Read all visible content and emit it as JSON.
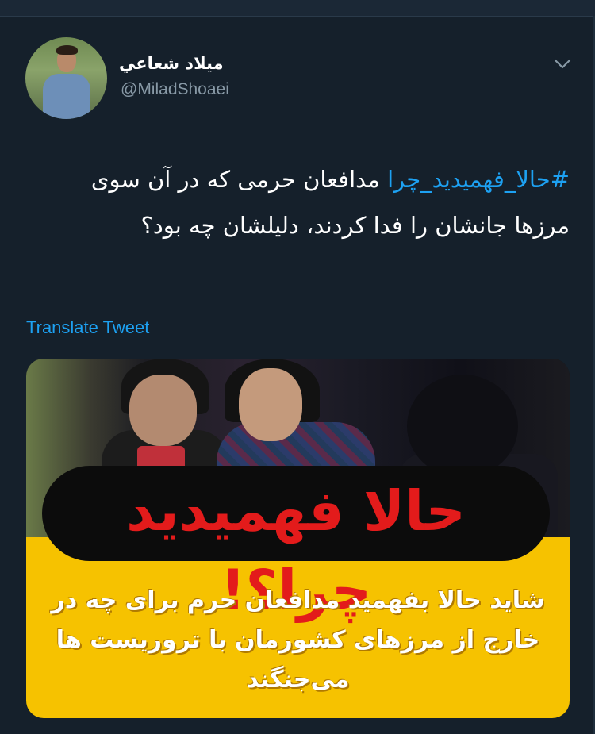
{
  "tweet": {
    "display_name": "ميلاد شعاعي",
    "handle": "@MiladShoaei",
    "hashtag": "#حالا_فهمیدید_چرا",
    "text": " مدافعان حرمی که در آن سوی مرزها جانشان را فدا کردند، دلیلشان چه بود؟",
    "translate_label": "Translate Tweet",
    "menu_icon": "chevron-down-icon"
  },
  "media": {
    "headline": "حالا فهمیدید چرا؟!",
    "subtext_line1": "شاید حالا بفهمید  مدافعان حرم برای چه در",
    "subtext_line2": "خارج از مرزهای کشورمان با تروریست ها",
    "subtext_line3": "می‌جنگند"
  },
  "colors": {
    "background": "#15202b",
    "link": "#1da1f2",
    "secondary_text": "#8899a6",
    "headline_red": "#e31b1b",
    "banner_yellow": "#f6c200"
  }
}
